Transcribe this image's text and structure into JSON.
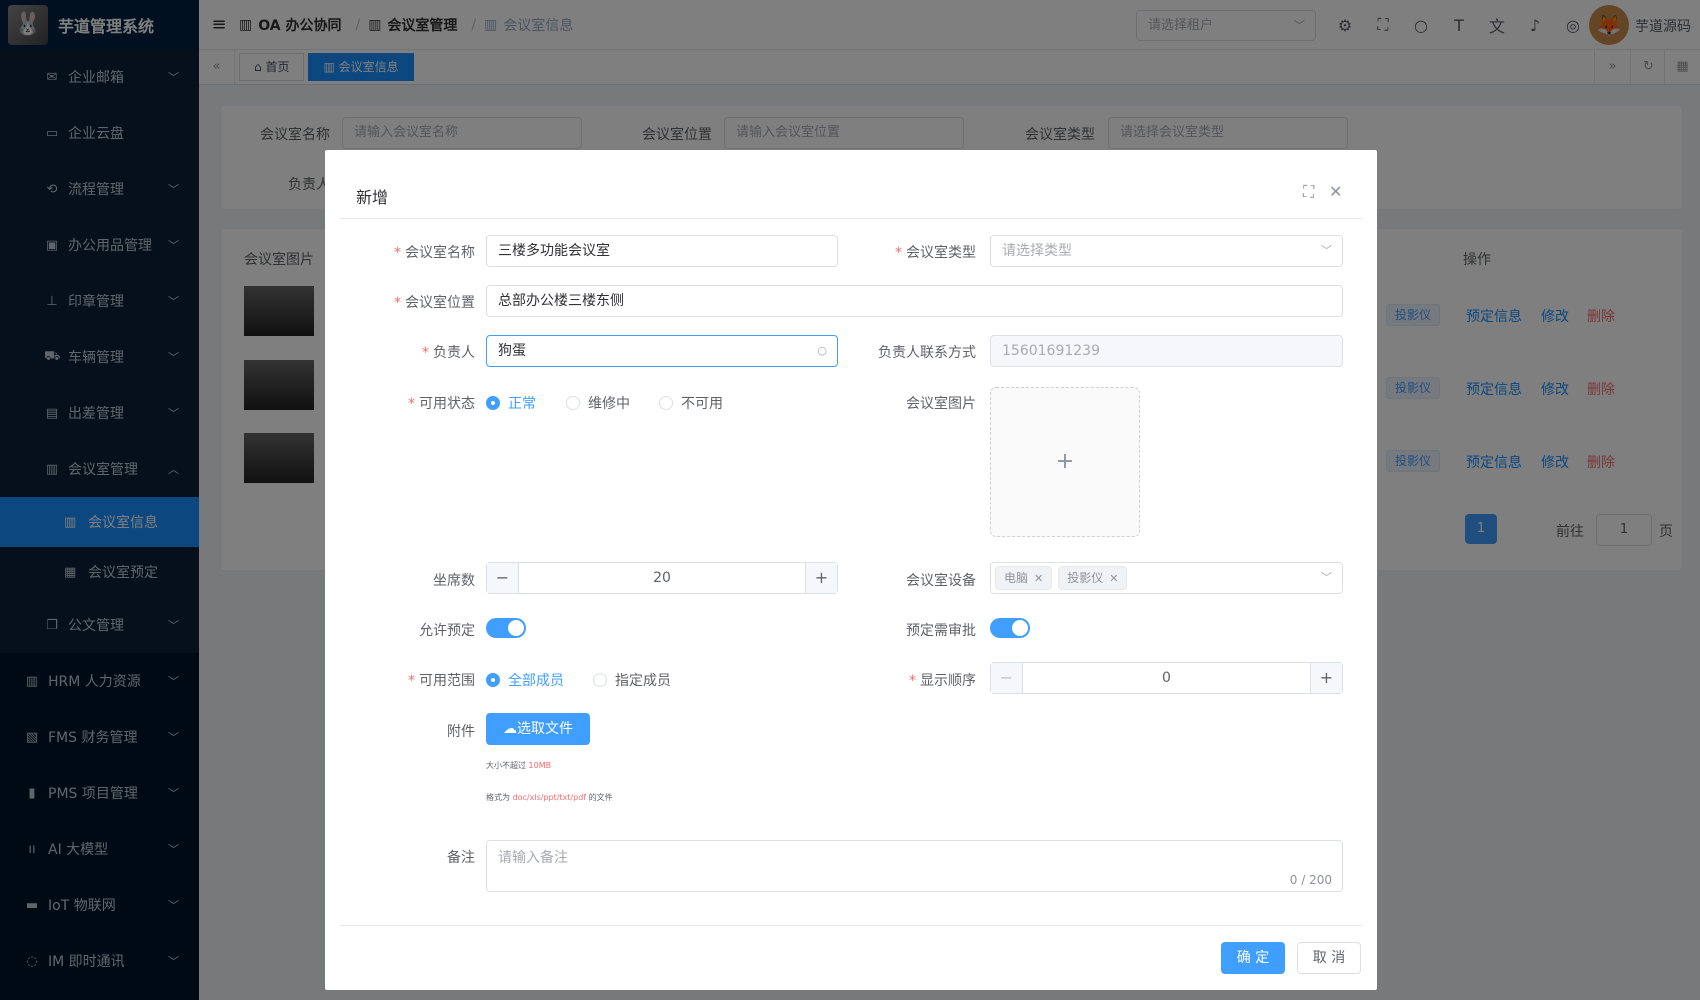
{
  "app": {
    "title": "芋道管理系统"
  },
  "sidebar": {
    "items": [
      {
        "label": "企业邮箱"
      },
      {
        "label": "企业云盘"
      },
      {
        "label": "流程管理"
      },
      {
        "label": "办公用品管理"
      },
      {
        "label": "印章管理"
      },
      {
        "label": "车辆管理"
      },
      {
        "label": "出差管理"
      },
      {
        "label": "会议室管理"
      },
      {
        "label": "会议室信息"
      },
      {
        "label": "会议室预定"
      },
      {
        "label": "公文管理"
      },
      {
        "label": "HRM 人力资源"
      },
      {
        "label": "FMS 财务管理"
      },
      {
        "label": "PMS 项目管理"
      },
      {
        "label": "AI 大模型"
      },
      {
        "label": "IoT 物联网"
      },
      {
        "label": "IM 即时通讯"
      }
    ]
  },
  "navbar": {
    "breadcrumb": [
      "OA 办公协同",
      "会议室管理",
      "会议室信息"
    ],
    "tenant_placeholder": "请选择租户",
    "username": "芋道源码"
  },
  "tags": {
    "home": "首页",
    "current": "会议室信息"
  },
  "search": {
    "name_label": "会议室名称",
    "name_placeholder": "请输入会议室名称",
    "location_label": "会议室位置",
    "location_placeholder": "请输入会议室位置",
    "type_label": "会议室类型",
    "type_placeholder": "请选择会议室类型",
    "owner_label": "负责人"
  },
  "table": {
    "image_header": "会议室图片",
    "action_header": "操作",
    "rows": [
      {
        "badge": "投影仪",
        "reserve": "预定信息",
        "edit": "修改",
        "delete": "删除"
      },
      {
        "badge": "投影仪",
        "reserve": "预定信息",
        "edit": "修改",
        "delete": "删除"
      },
      {
        "badge": "投影仪",
        "reserve": "预定信息",
        "edit": "修改",
        "delete": "删除"
      }
    ],
    "pagination": {
      "current": "1",
      "goto": "前往",
      "page_input": "1",
      "page_unit": "页"
    }
  },
  "dialog": {
    "title": "新增",
    "name_label": "会议室名称",
    "name_value": "三楼多功能会议室",
    "type_label": "会议室类型",
    "type_placeholder": "请选择类型",
    "location_label": "会议室位置",
    "location_value": "总部办公楼三楼东侧",
    "owner_label": "负责人",
    "owner_value": "狗蛋",
    "contact_label": "负责人联系方式",
    "contact_value": "15601691239",
    "status_label": "可用状态",
    "status_options": [
      "正常",
      "维修中",
      "不可用"
    ],
    "image_label": "会议室图片",
    "seats_label": "坐席数",
    "seats_value": "20",
    "equipment_label": "会议室设备",
    "equipment_tags": [
      "电脑",
      "投影仪"
    ],
    "allow_reserve_label": "允许预定",
    "need_approval_label": "预定需审批",
    "scope_label": "可用范围",
    "scope_options": [
      "全部成员",
      "指定成员"
    ],
    "sort_label": "显示顺序",
    "sort_value": "0",
    "attachment_label": "附件",
    "upload_button": "选取文件",
    "tip_size_prefix": "大小不超过",
    "tip_size_value": "10MB",
    "tip_format_prefix": "格式为",
    "tip_format_value": "doc/xls/ppt/txt/pdf",
    "tip_format_suffix": "的文件",
    "remark_label": "备注",
    "remark_placeholder": "请输入备注",
    "remark_counter": "0 / 200",
    "confirm_button": "确 定",
    "cancel_button": "取 消"
  }
}
